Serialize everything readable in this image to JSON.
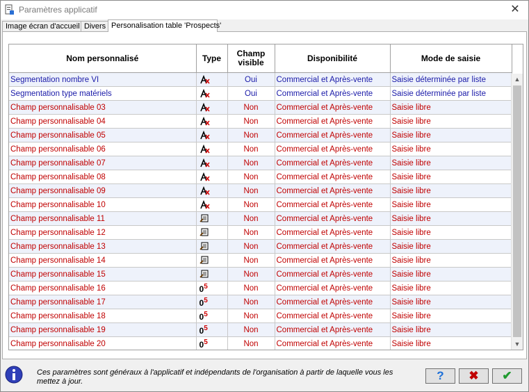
{
  "window": {
    "title": "Paramètres applicatif",
    "close_glyph": "✕"
  },
  "tabs": [
    {
      "label": "Image écran d'accueil",
      "active": false
    },
    {
      "label": "Divers",
      "active": false
    },
    {
      "label": "Personalisation table 'Prospects'",
      "active": true
    }
  ],
  "table": {
    "headers": {
      "name": "Nom personnalisé",
      "type": "Type",
      "visible_line1": "Champ",
      "visible_line2": "visible",
      "availability": "Disponibilité",
      "mode": "Mode de saisie"
    },
    "rows": [
      {
        "name": "Segmentation nombre VI",
        "type_icon": "text-type-icon",
        "visible": "Oui",
        "availability": "Commercial et Après-vente",
        "mode": "Saisie déterminée par liste",
        "color": "blue"
      },
      {
        "name": "Segmentation type matériels",
        "type_icon": "text-type-icon",
        "visible": "Oui",
        "availability": "Commercial et Après-vente",
        "mode": "Saisie déterminée par liste",
        "color": "blue"
      },
      {
        "name": "Champ personnalisable 03",
        "type_icon": "text-type-icon",
        "visible": "Non",
        "availability": "Commercial et Après-vente",
        "mode": "Saisie libre",
        "color": "red"
      },
      {
        "name": "Champ personnalisable 04",
        "type_icon": "text-type-icon",
        "visible": "Non",
        "availability": "Commercial et Après-vente",
        "mode": "Saisie libre",
        "color": "red"
      },
      {
        "name": "Champ personnalisable 05",
        "type_icon": "text-type-icon",
        "visible": "Non",
        "availability": "Commercial et Après-vente",
        "mode": "Saisie libre",
        "color": "red"
      },
      {
        "name": "Champ personnalisable 06",
        "type_icon": "text-type-icon",
        "visible": "Non",
        "availability": "Commercial et Après-vente",
        "mode": "Saisie libre",
        "color": "red"
      },
      {
        "name": "Champ personnalisable 07",
        "type_icon": "text-type-icon",
        "visible": "Non",
        "availability": "Commercial et Après-vente",
        "mode": "Saisie libre",
        "color": "red"
      },
      {
        "name": "Champ personnalisable 08",
        "type_icon": "text-type-icon",
        "visible": "Non",
        "availability": "Commercial et Après-vente",
        "mode": "Saisie libre",
        "color": "red"
      },
      {
        "name": "Champ personnalisable 09",
        "type_icon": "text-type-icon",
        "visible": "Non",
        "availability": "Commercial et Après-vente",
        "mode": "Saisie libre",
        "color": "red"
      },
      {
        "name": "Champ personnalisable 10",
        "type_icon": "text-type-icon",
        "visible": "Non",
        "availability": "Commercial et Après-vente",
        "mode": "Saisie libre",
        "color": "red"
      },
      {
        "name": "Champ personnalisable 11",
        "type_icon": "memo-type-icon",
        "visible": "Non",
        "availability": "Commercial et Après-vente",
        "mode": "Saisie libre",
        "color": "red"
      },
      {
        "name": "Champ personnalisable 12",
        "type_icon": "memo-type-icon",
        "visible": "Non",
        "availability": "Commercial et Après-vente",
        "mode": "Saisie libre",
        "color": "red"
      },
      {
        "name": "Champ personnalisable 13",
        "type_icon": "memo-type-icon",
        "visible": "Non",
        "availability": "Commercial et Après-vente",
        "mode": "Saisie libre",
        "color": "red"
      },
      {
        "name": "Champ personnalisable 14",
        "type_icon": "memo-type-icon",
        "visible": "Non",
        "availability": "Commercial et Après-vente",
        "mode": "Saisie libre",
        "color": "red"
      },
      {
        "name": "Champ personnalisable 15",
        "type_icon": "memo-type-icon",
        "visible": "Non",
        "availability": "Commercial et Après-vente",
        "mode": "Saisie libre",
        "color": "red"
      },
      {
        "name": "Champ personnalisable 16",
        "type_icon": "numeric-type-icon",
        "visible": "Non",
        "availability": "Commercial et Après-vente",
        "mode": "Saisie libre",
        "color": "red"
      },
      {
        "name": "Champ personnalisable 17",
        "type_icon": "numeric-type-icon",
        "visible": "Non",
        "availability": "Commercial et Après-vente",
        "mode": "Saisie libre",
        "color": "red"
      },
      {
        "name": "Champ personnalisable 18",
        "type_icon": "numeric-type-icon",
        "visible": "Non",
        "availability": "Commercial et Après-vente",
        "mode": "Saisie libre",
        "color": "red"
      },
      {
        "name": "Champ personnalisable 19",
        "type_icon": "numeric-type-icon",
        "visible": "Non",
        "availability": "Commercial et Après-vente",
        "mode": "Saisie libre",
        "color": "red"
      },
      {
        "name": "Champ personnalisable 20",
        "type_icon": "numeric-type-icon",
        "visible": "Non",
        "availability": "Commercial et Après-vente",
        "mode": "Saisie libre",
        "color": "red"
      }
    ]
  },
  "numeric_icon": {
    "digit": "0",
    "exponent": "5"
  },
  "footer": {
    "info_icon": "info-icon",
    "text": "Ces paramètres sont généraux à l'applicatif et indépendants de l'organisation à partir de laquelle vous les mettez à jour.",
    "help_glyph": "?",
    "cancel_glyph": "✖",
    "ok_glyph": "✔"
  },
  "colors": {
    "link_blue": "#1a1aa8",
    "red_text": "#c00000",
    "row_alt": "#eef2fb",
    "help": "#1a6ed8",
    "cancel": "#c00000",
    "ok": "#1f9a2f"
  }
}
